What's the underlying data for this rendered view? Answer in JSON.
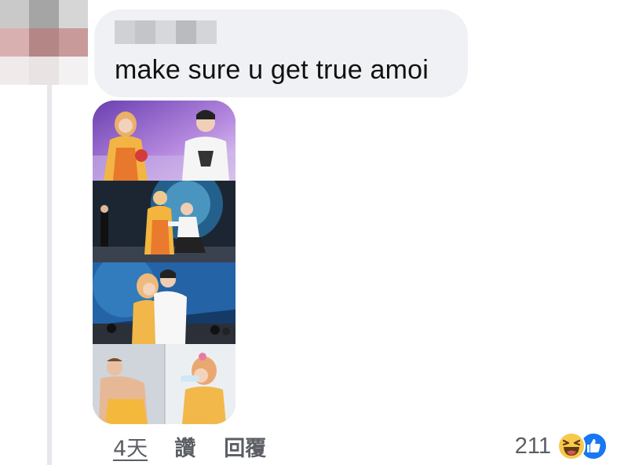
{
  "comment": {
    "text": "make sure u get true amoi",
    "author_name_redacted": true
  },
  "actions": {
    "time": "4天",
    "like_label": "讚",
    "reply_label": "回覆"
  },
  "reactions": {
    "count": "211",
    "types": [
      "haha-emoji",
      "like-emoji"
    ]
  },
  "colors": {
    "bubble_bg": "#eff1f4",
    "text": "#111111",
    "meta_text": "#5b5e63",
    "like_blue": "#1877f2",
    "haha_yellow": "#f7c84b"
  },
  "avatar": {
    "pixel_colors": [
      "#c9c9c9",
      "#a5a5a5",
      "#d6d6d6",
      "#d9b0b0",
      "#b58686",
      "#c99a9a",
      "#f1eaea",
      "#e9e3e3",
      "#f3f1f1"
    ]
  },
  "attachment": {
    "type": "photo-collage",
    "panels": [
      "stage-costume-scene",
      "kneeling-proposal-scene",
      "embrace-scene",
      "backstage-scene"
    ]
  }
}
